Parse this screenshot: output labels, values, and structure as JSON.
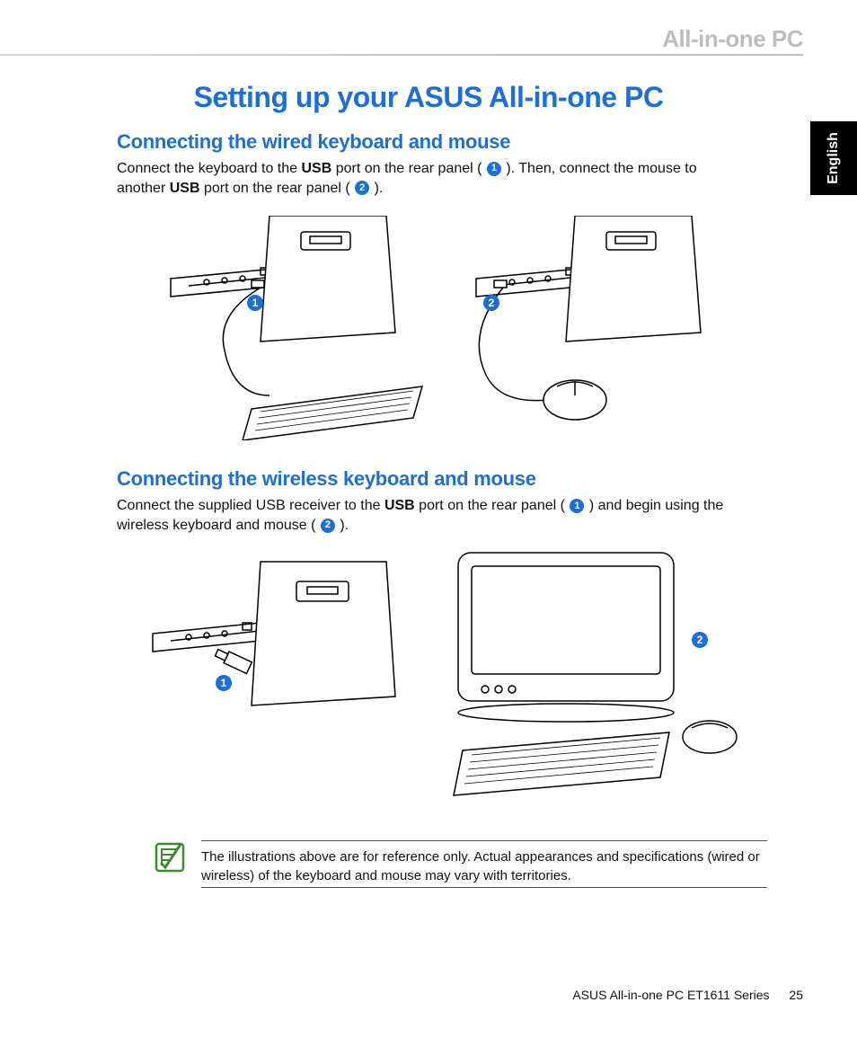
{
  "header": {
    "brand": "All-in-one PC"
  },
  "language_tab": "English",
  "title": "Setting up your ASUS All-in-one PC",
  "section1": {
    "heading": "Connecting the wired keyboard and mouse",
    "p1a": "Connect the keyboard to the ",
    "p1b_bold": "USB",
    "p1c": " port on the rear panel ( ",
    "p1_marker1": "1",
    "p1d": " ). Then, connect the mouse to another ",
    "p1e_bold": "USB",
    "p1f": " port on the rear panel ( ",
    "p1_marker2": "2",
    "p1g": " )."
  },
  "section2": {
    "heading": "Connecting the wireless keyboard and mouse",
    "p1a": "Connect the supplied USB receiver to the ",
    "p1b_bold": "USB",
    "p1c": " port on the rear panel ( ",
    "p1_marker1": "1",
    "p1d": " ) and begin using the wireless keyboard and mouse ( ",
    "p1_marker2": "2",
    "p1e": " )."
  },
  "figure_markers": {
    "s1_left": "1",
    "s1_right": "2",
    "s2_left": "1",
    "s2_right": "2"
  },
  "note": {
    "text": "The illustrations above are for reference only. Actual appearances and specifications (wired or wireless) of the keyboard and mouse may vary with territories."
  },
  "footer": {
    "product": "ASUS All-in-one PC  ET1611 Series",
    "page_number": "25"
  }
}
